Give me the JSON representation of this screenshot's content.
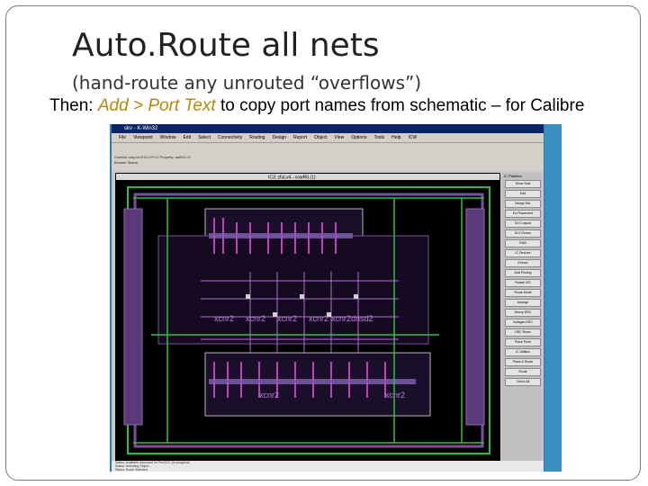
{
  "slide": {
    "title": "Auto.Route all nets",
    "subtitle": "(hand-route any unrouted “overflows”)",
    "body_prefix": "Then: ",
    "body_highlight": "Add > Port Text",
    "body_suffix": " to copy port names from schematic – for Calibre"
  },
  "screenshot": {
    "window_title": "skv - K-Win32",
    "canvas_label": "IC3: zfuLv4 - cowR0.(1)",
    "menu_items": [
      "File",
      "Viewpoint",
      "Window",
      "Edit",
      "Select",
      "Connectivity",
      "Routing",
      "Design",
      "Report",
      "Object",
      "View",
      "Options",
      "Tools",
      "Help",
      "ICW"
    ],
    "status_line1": "Context: cmp:ld IC3:C>P:C/ Property: autDS->0",
    "status_line2": "Browse Status:",
    "panel_title": "IC Palettes",
    "panel_buttons": [
      "Show Sold",
      "Edit",
      "Design Std.",
      "Ext Placement",
      "DLV Layout",
      "DLV Device",
      "FWD",
      "IC Devices",
      "Extract",
      "Add Pinning",
      "Rotate ICD",
      "Route Mode",
      "Arrange",
      "Reexp DRC",
      "Voltages DRC",
      "DRC Rules",
      "Place Ports",
      "IC Utilities",
      "Place & Route",
      "Route",
      "Check All"
    ],
    "net_labels": [
      "xcnr2",
      "xcnr2",
      "xcnr2",
      "xcnr2",
      "xcnr2",
      "dnsd2",
      "xcnr2",
      "xcnr2"
    ],
    "bottom_lines": [
      "Status: Available resources for PreXCC: (in progress)",
      "Status: Selecting Object...",
      "Status: Route Selected"
    ],
    "colors": {
      "slide_bg": "#ffffff",
      "accent_text": "#b8860b",
      "canvas_bg": "#000000",
      "metal1": "#7a4f9c",
      "metal2": "#2fbf3f",
      "poly": "#c040c0",
      "diffusion": "#8060b0"
    }
  }
}
